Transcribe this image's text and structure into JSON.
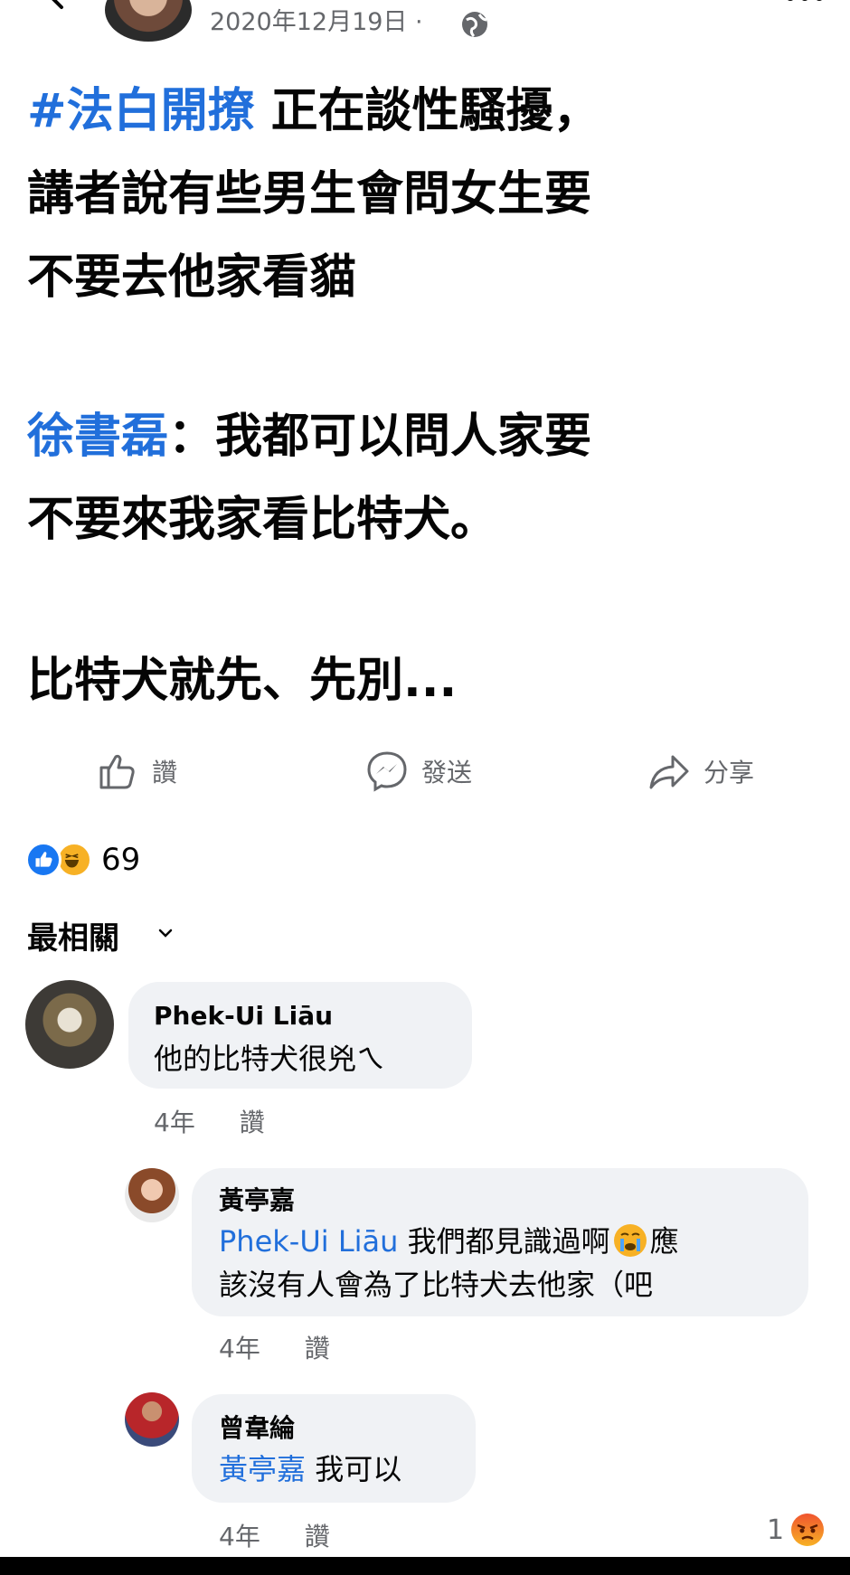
{
  "header": {
    "date": "2020年12月19日",
    "separator": "·"
  },
  "post": {
    "line1_hashtag": "#法白開撩",
    "line1_rest": " 正在談性騷擾，",
    "line2": "講者說有些男生會問女生要",
    "line3": "不要去他家看貓",
    "line4_name": "徐書磊",
    "line4_rest": "：我都可以問人家要",
    "line5": "不要來我家看比特犬。",
    "line6": "比特犬就先、先別..."
  },
  "actions": {
    "like": "讚",
    "send": "發送",
    "share": "分享"
  },
  "reactions": {
    "count": "69"
  },
  "sort": {
    "label": "最相關"
  },
  "comments": [
    {
      "name": "Phek-Ui Liāu",
      "text": "他的比特犬很兇ㄟ",
      "time": "4年",
      "like": "讚"
    },
    {
      "name": "黃亭嘉",
      "mention": "Phek-Ui Liāu",
      "text_part1": " 我們都見識過啊",
      "text_part2": "應",
      "text_line2": "該沒有人會為了比特犬去他家（吧",
      "time": "4年",
      "like": "讚"
    },
    {
      "name": "曾韋綸",
      "mention": "黃亭嘉",
      "text": " 我可以",
      "time": "4年",
      "like": "讚",
      "reaction_count": "1"
    }
  ],
  "colors": {
    "link": "#216fdb",
    "secondary_text": "#65676b",
    "bubble": "#f0f2f5",
    "like_blue": "#1877f2"
  }
}
